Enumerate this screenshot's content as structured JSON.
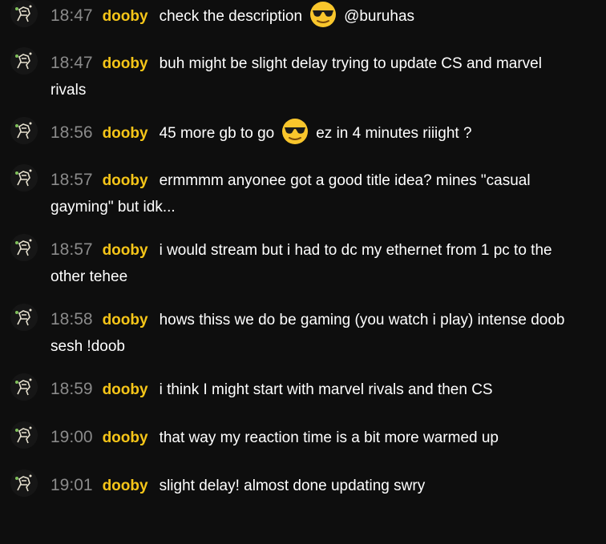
{
  "chat": {
    "messages": [
      {
        "time": "18:47",
        "user": "dooby",
        "parts": [
          "check the description",
          "@buruhas"
        ],
        "emoji": "sunglasses-face"
      },
      {
        "time": "18:47",
        "user": "dooby",
        "line1": "buh might be slight delay trying to update CS and marvel",
        "line2": "rivals"
      },
      {
        "time": "18:56",
        "user": "dooby",
        "parts": [
          "45 more gb to go",
          "ez in 4 minutes riiight ?"
        ],
        "emoji": "sunglasses-face"
      },
      {
        "time": "18:57",
        "user": "dooby",
        "line1": "ermmmm anyonee got a good title idea? mines \"casual",
        "line2": "gayming\" but idk..."
      },
      {
        "time": "18:57",
        "user": "dooby",
        "line1": "i would stream but i had to dc my ethernet from 1 pc to the",
        "line2": "other tehee"
      },
      {
        "time": "18:58",
        "user": "dooby",
        "line1": "hows thiss we do be gaming (you watch i play) intense doob",
        "line2": "sesh !doob"
      },
      {
        "time": "18:59",
        "user": "dooby",
        "line1": "i think I might start with marvel rivals and then CS"
      },
      {
        "time": "19:00",
        "user": "dooby",
        "line1": "that way my reaction time is a bit more warmed up"
      },
      {
        "time": "19:01",
        "user": "dooby",
        "line1": "slight delay! almost done updating swry"
      }
    ]
  },
  "colors": {
    "background": "#0e0e0e",
    "username": "#f5c518",
    "timestamp": "#8a8a8a",
    "text": "#ffffff"
  }
}
